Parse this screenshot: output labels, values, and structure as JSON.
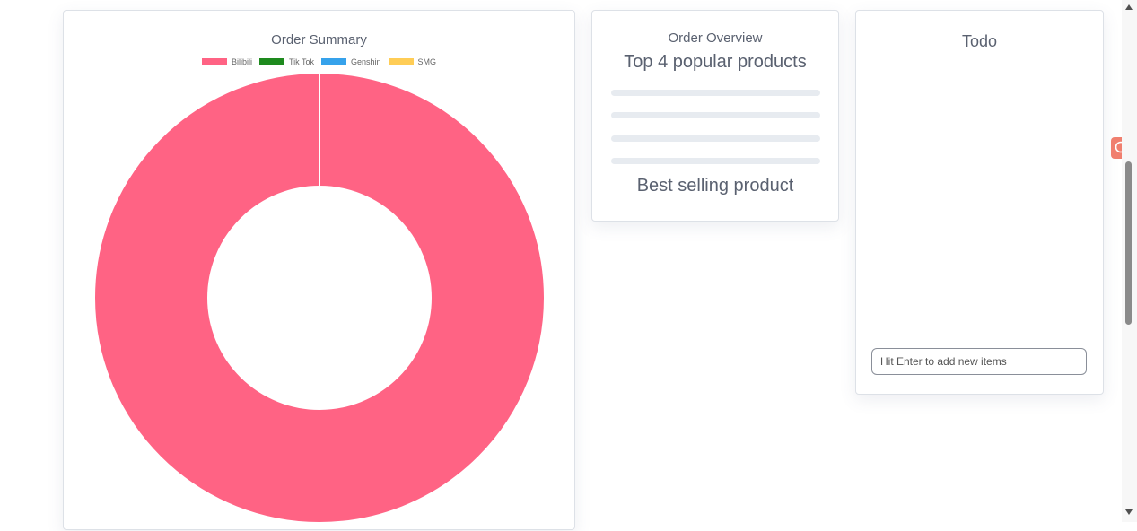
{
  "order_summary": {
    "title": "Order Summary"
  },
  "chart_data": {
    "type": "doughnut",
    "title": "Order Summary",
    "categories": [
      "Bilibili",
      "Tik Tok",
      "Genshin",
      "SMG"
    ],
    "values": [
      1,
      0,
      0,
      0
    ],
    "colors": [
      "#ff6384",
      "#1e8a1e",
      "#36a2eb",
      "#ffcd56"
    ],
    "legend_position": "top"
  },
  "order_overview": {
    "title": "Order Overview",
    "heading": "Top 4 popular products",
    "best_selling": "Best selling product"
  },
  "todo": {
    "title": "Todo",
    "input_placeholder": "Hit Enter to add new items"
  },
  "icons": {
    "search_fab": "search-icon"
  }
}
